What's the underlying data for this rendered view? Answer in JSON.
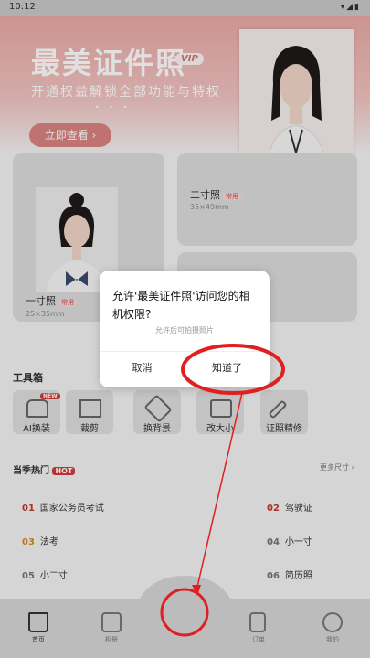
{
  "status": {
    "time": "10:12",
    "icons": "▾◢▮"
  },
  "banner": {
    "title": "最美证件照",
    "vip": "VIP",
    "subtitle": "开通权益解锁全部功能与特权",
    "dots": "• • •",
    "cta": "立即查看 ›"
  },
  "cards": [
    {
      "title": "一寸照",
      "tag": "常用",
      "size": "25×35mm"
    },
    {
      "title": "二寸照",
      "tag": "常用",
      "size": "35×49mm"
    }
  ],
  "toolbox": {
    "title": "工具箱",
    "tools": [
      {
        "label": "AI换装",
        "badge": "NEW",
        "icon": "shirt-icon"
      },
      {
        "label": "裁剪",
        "icon": "crop-icon"
      },
      {
        "label": "换背景",
        "icon": "paint-bucket-icon"
      },
      {
        "label": "改大小",
        "icon": "resize-icon"
      },
      {
        "label": "证照精修",
        "icon": "magic-wand-icon"
      }
    ]
  },
  "hot": {
    "title": "当季热门",
    "badge": "HOT",
    "more": "更多尺寸 ›",
    "items": [
      {
        "num": "01",
        "label": "国家公务员考试",
        "color": "#c0392b"
      },
      {
        "num": "02",
        "label": "驾驶证",
        "color": "#c0392b"
      },
      {
        "num": "03",
        "label": "法考",
        "color": "#d4861f"
      },
      {
        "num": "04",
        "label": "小一寸",
        "color": "#777777"
      },
      {
        "num": "05",
        "label": "小二寸",
        "color": "#777777"
      },
      {
        "num": "06",
        "label": "简历照",
        "color": "#777777"
      }
    ]
  },
  "tabbar": {
    "tabs": [
      {
        "label": "首页",
        "icon": "home-icon"
      },
      {
        "label": "相册",
        "icon": "album-icon"
      },
      {
        "label": "订单",
        "icon": "clipboard-icon"
      },
      {
        "label": "我的",
        "icon": "profile-icon"
      }
    ]
  },
  "dialog": {
    "title": "允许'最美证件照'访问您的相机权限?",
    "subtitle": "允许后可拍摄照片",
    "cancel": "取消",
    "ok": "知道了"
  },
  "colors": {
    "accent": "#d23a3a",
    "annotation": "#e02020"
  }
}
